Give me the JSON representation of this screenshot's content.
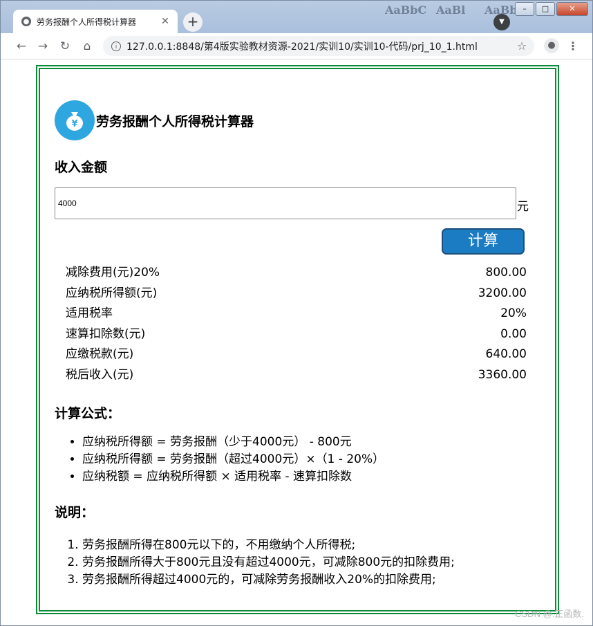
{
  "browser": {
    "tab_title": "劳务报酬个人所得税计算器",
    "url": "127.0.0.1:8848/第4版实验教材资源-2021/实训10/实训10-代码/prj_10_1.html",
    "background_text": [
      "AaBbC",
      "AaBl",
      "AaBb"
    ]
  },
  "app": {
    "title": "劳务报酬个人所得税计算器",
    "logo_symbol": "¥",
    "income_heading": "收入金额",
    "income_value": "4000",
    "unit": "元",
    "calculate_label": "计算"
  },
  "results": [
    {
      "label": "减除费用(元)20%",
      "value": "800.00"
    },
    {
      "label": "应纳税所得额(元)",
      "value": "3200.00"
    },
    {
      "label": "适用税率",
      "value": "20%"
    },
    {
      "label": "速算扣除数(元)",
      "value": "0.00"
    },
    {
      "label": "应缴税款(元)",
      "value": "640.00"
    },
    {
      "label": "税后收入(元)",
      "value": "3360.00"
    }
  ],
  "formula": {
    "heading": "计算公式：",
    "items": [
      "应纳税所得额 = 劳务报酬（少于4000元） - 800元",
      "应纳税所得额 = 劳务报酬（超过4000元）×（1 - 20%）",
      "应纳税额 = 应纳税所得额 × 适用税率 - 速算扣除数"
    ]
  },
  "notes": {
    "heading": "说明：",
    "items": [
      "劳务报酬所得在800元以下的，不用缴纳个人所得税;",
      "劳务报酬所得大于800元且没有超过4000元，可减除800元的扣除费用;",
      "劳务报酬所得超过4000元的，可减除劳务报酬收入20%的扣除费用;"
    ]
  },
  "watermark": "CSDN @.正函数.",
  "colors": {
    "accent": "#1b7cc4",
    "frame": "#0c8a3a",
    "logo": "#2ea7e0"
  }
}
